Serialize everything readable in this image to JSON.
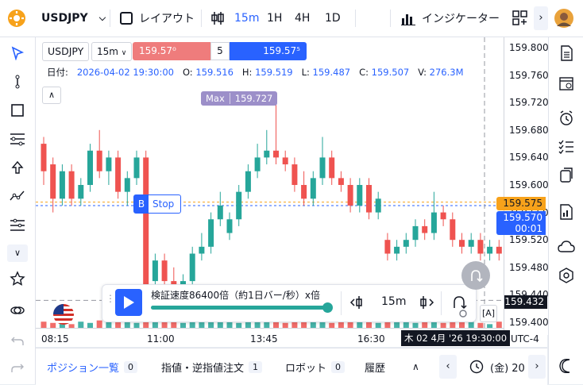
{
  "topbar": {
    "symbol": "USDJPY",
    "layout_label": "レイアウト",
    "intervals": [
      "15m",
      "1H",
      "4H",
      "1D"
    ],
    "active_interval": "15m",
    "indicators_label": "インジケーター"
  },
  "chart": {
    "symbol_box": "USDJPY",
    "interval_box": "15m",
    "sell_price": "159.57⁰",
    "quantity": "5",
    "buy_price": "159.57⁵",
    "legend": {
      "date_label": "日付:",
      "date_value": "2026-04-02 19:30:00",
      "open_label": "O:",
      "open": "159.516",
      "high_label": "H:",
      "high": "159.519",
      "low_label": "L:",
      "low": "159.487",
      "close_label": "C:",
      "close": "159.507",
      "volume_label": "V:",
      "volume": "276.3M"
    },
    "max_label": "Max",
    "max_value": "159.727",
    "stop_letter": "B",
    "stop_label": "Stop",
    "price_ticks": [
      "159.800",
      "159.760",
      "159.720",
      "159.680",
      "159.640",
      "159.600",
      "159.560",
      "159.520",
      "159.480",
      "159.440",
      "159.400"
    ],
    "price_tag_orange": "159.575",
    "price_tag_blue": "159.570",
    "price_tag_blue_sub": "00:01",
    "price_tag_dark": "159.432",
    "time_labels": [
      "08:15",
      "11:00",
      "13:45",
      "16:30"
    ],
    "crosshair_time": "木 02 4月 '26 19:30:00",
    "timezone": "UTC-4"
  },
  "replay": {
    "speed_text": "検証速度86400倍（約1日バー/秒）x倍",
    "progress": 1.0,
    "interval": "15m"
  },
  "bottombar": {
    "positions_label": "ポジション一覧",
    "positions_count": "0",
    "orders_label": "指値・逆指値注文",
    "orders_count": "1",
    "robot_label": "ロボット",
    "robot_count": "0",
    "history_label": "履歴",
    "date_text": "(金) 20"
  },
  "colors": {
    "up": "#26a69a",
    "down": "#ef5350",
    "accent": "#2962ff",
    "orange": "#f7a21b",
    "max_purple": "#9c8fc9"
  },
  "chart_data": {
    "type": "candlestick",
    "ylim": [
      159.4,
      159.8
    ],
    "candles": [
      {
        "o": 159.66,
        "c": 159.62,
        "h": 159.67,
        "l": 159.6
      },
      {
        "o": 159.63,
        "c": 159.58,
        "h": 159.64,
        "l": 159.56
      },
      {
        "o": 159.58,
        "c": 159.62,
        "h": 159.63,
        "l": 159.57
      },
      {
        "o": 159.62,
        "c": 159.58,
        "h": 159.63,
        "l": 159.57
      },
      {
        "o": 159.58,
        "c": 159.6,
        "h": 159.61,
        "l": 159.57
      },
      {
        "o": 159.6,
        "c": 159.65,
        "h": 159.66,
        "l": 159.59
      },
      {
        "o": 159.65,
        "c": 159.62,
        "h": 159.68,
        "l": 159.61
      },
      {
        "o": 159.62,
        "c": 159.64,
        "h": 159.65,
        "l": 159.6
      },
      {
        "o": 159.64,
        "c": 159.59,
        "h": 159.65,
        "l": 159.58
      },
      {
        "o": 159.59,
        "c": 159.61,
        "h": 159.62,
        "l": 159.57
      },
      {
        "o": 159.61,
        "c": 159.64,
        "h": 159.65,
        "l": 159.6
      },
      {
        "o": 159.64,
        "c": 159.41,
        "h": 159.65,
        "l": 159.4
      },
      {
        "o": 159.46,
        "c": 159.49,
        "h": 159.5,
        "l": 159.42
      },
      {
        "o": 159.49,
        "c": 159.46,
        "h": 159.5,
        "l": 159.44
      },
      {
        "o": 159.46,
        "c": 159.44,
        "h": 159.48,
        "l": 159.43
      },
      {
        "o": 159.44,
        "c": 159.46,
        "h": 159.47,
        "l": 159.43
      },
      {
        "o": 159.46,
        "c": 159.5,
        "h": 159.51,
        "l": 159.45
      },
      {
        "o": 159.5,
        "c": 159.51,
        "h": 159.53,
        "l": 159.49
      },
      {
        "o": 159.51,
        "c": 159.55,
        "h": 159.56,
        "l": 159.5
      },
      {
        "o": 159.55,
        "c": 159.57,
        "h": 159.59,
        "l": 159.54
      },
      {
        "o": 159.53,
        "c": 159.55,
        "h": 159.56,
        "l": 159.52
      },
      {
        "o": 159.55,
        "c": 159.59,
        "h": 159.6,
        "l": 159.54
      },
      {
        "o": 159.59,
        "c": 159.62,
        "h": 159.63,
        "l": 159.58
      },
      {
        "o": 159.62,
        "c": 159.64,
        "h": 159.66,
        "l": 159.61
      },
      {
        "o": 159.64,
        "c": 159.65,
        "h": 159.68,
        "l": 159.63
      },
      {
        "o": 159.65,
        "c": 159.64,
        "h": 159.727,
        "l": 159.63
      },
      {
        "o": 159.64,
        "c": 159.63,
        "h": 159.65,
        "l": 159.62
      },
      {
        "o": 159.63,
        "c": 159.6,
        "h": 159.64,
        "l": 159.59
      },
      {
        "o": 159.6,
        "c": 159.58,
        "h": 159.62,
        "l": 159.57
      },
      {
        "o": 159.58,
        "c": 159.61,
        "h": 159.62,
        "l": 159.57
      },
      {
        "o": 159.61,
        "c": 159.64,
        "h": 159.67,
        "l": 159.6
      },
      {
        "o": 159.64,
        "c": 159.61,
        "h": 159.65,
        "l": 159.6
      },
      {
        "o": 159.61,
        "c": 159.6,
        "h": 159.62,
        "l": 159.59
      },
      {
        "o": 159.6,
        "c": 159.57,
        "h": 159.61,
        "l": 159.56
      },
      {
        "o": 159.57,
        "c": 159.6,
        "h": 159.61,
        "l": 159.56
      },
      {
        "o": 159.6,
        "c": 159.56,
        "h": 159.61,
        "l": 159.55
      },
      {
        "o": 159.56,
        "c": 159.58,
        "h": 159.59,
        "l": 159.55
      },
      {
        "o": 159.52,
        "c": 159.5,
        "h": 159.53,
        "l": 159.49
      },
      {
        "o": 159.5,
        "c": 159.51,
        "h": 159.52,
        "l": 159.49
      },
      {
        "o": 159.51,
        "c": 159.52,
        "h": 159.53,
        "l": 159.5
      },
      {
        "o": 159.52,
        "c": 159.54,
        "h": 159.55,
        "l": 159.51
      },
      {
        "o": 159.54,
        "c": 159.53,
        "h": 159.55,
        "l": 159.52
      },
      {
        "o": 159.53,
        "c": 159.56,
        "h": 159.59,
        "l": 159.52
      },
      {
        "o": 159.56,
        "c": 159.55,
        "h": 159.57,
        "l": 159.54
      },
      {
        "o": 159.55,
        "c": 159.52,
        "h": 159.56,
        "l": 159.51
      },
      {
        "o": 159.52,
        "c": 159.51,
        "h": 159.53,
        "l": 159.5
      },
      {
        "o": 159.51,
        "c": 159.52,
        "h": 159.53,
        "l": 159.5
      },
      {
        "o": 159.52,
        "c": 159.5,
        "h": 159.53,
        "l": 159.49
      },
      {
        "o": 159.5,
        "c": 159.51,
        "h": 159.52,
        "l": 159.49
      },
      {
        "o": 159.51,
        "c": 159.5,
        "h": 159.52,
        "l": 159.49
      },
      {
        "o": 159.5,
        "c": 159.49,
        "h": 159.51,
        "l": 159.48
      }
    ],
    "volumes": [
      5,
      4,
      6,
      3,
      5,
      4,
      6,
      7,
      5,
      6,
      4,
      9,
      7,
      6,
      5,
      4,
      8,
      6,
      5,
      7,
      6,
      4,
      5,
      6,
      7,
      5,
      4,
      6,
      8,
      5,
      6,
      4,
      5,
      7,
      6,
      5,
      4,
      6,
      5,
      7,
      4,
      5,
      6,
      4,
      5,
      6,
      5,
      4,
      3,
      5,
      4
    ]
  }
}
